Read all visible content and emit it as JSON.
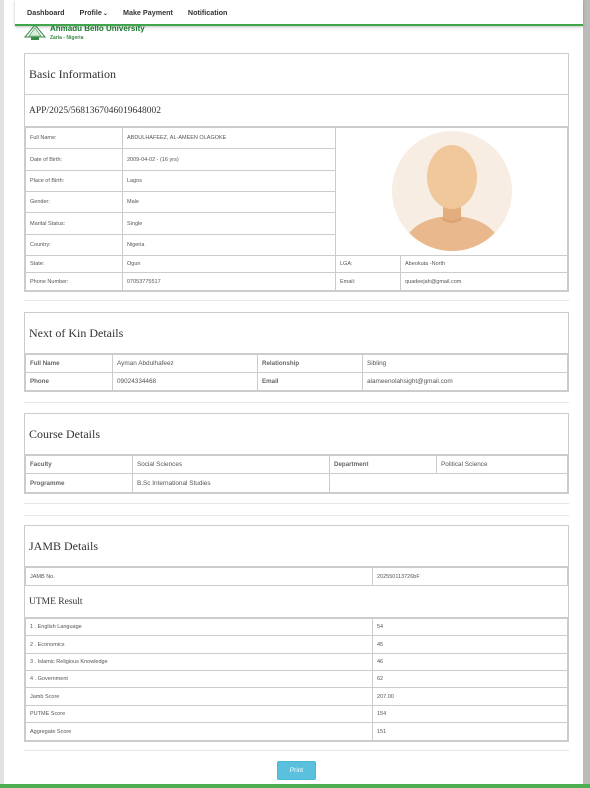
{
  "nav": {
    "dashboard": "Dashboard",
    "profile": "Profile",
    "payment": "Make Payment",
    "notification": "Notification"
  },
  "brand": {
    "name": "Ahmadu Bello University",
    "location": "Zaria - Nigeria"
  },
  "basic": {
    "title": "Basic Information",
    "app_no": "APP/2025/5681367046019648002",
    "rows": [
      {
        "label": "Full Name:",
        "value": "ABDULHAFEEZ, AL-AMEEN OLAGOKE"
      },
      {
        "label": "Date of Birth:",
        "value": "2009-04-02 - (16 yrs)"
      },
      {
        "label": "Place of Birth:",
        "value": "Lagos"
      },
      {
        "label": "Gender:",
        "value": "Male"
      },
      {
        "label": "Marital Status:",
        "value": "Single"
      },
      {
        "label": "Country:",
        "value": "Nigeria"
      }
    ],
    "state_label": "State:",
    "state": "Ogun",
    "lga_label": "LGA:",
    "lga": "Abeokuta -North",
    "phone_label": "Phone Number:",
    "phone": "07053775517",
    "email_label": "Email:",
    "email": "quadeejah@gmail.com"
  },
  "kin": {
    "title": "Next of Kin Details",
    "name_label": "Full Name",
    "name": "Ayman Abdulhafeez",
    "rel_label": "Relationship",
    "rel": "Sibling",
    "phone_label": "Phone",
    "phone": "09024334468",
    "email_label": "Email",
    "email": "alameenolahsight@gmail.com"
  },
  "course": {
    "title": "Course Details",
    "faculty_label": "Faculty",
    "faculty": "Social Sciences",
    "dept_label": "Department",
    "dept": "Political Science",
    "prog_label": "Programme",
    "prog": "B.Sc International Studies"
  },
  "jamb": {
    "title": "JAMB Details",
    "no_label": "JAMB No.",
    "no": "202550113726bF",
    "utme_title": "UTME Result",
    "rows": [
      {
        "label": "1 . English Language",
        "value": "54"
      },
      {
        "label": "2 . Economics",
        "value": "45"
      },
      {
        "label": "3 . Islamic Religious Knowledge",
        "value": "46"
      },
      {
        "label": "4 . Government",
        "value": "62"
      },
      {
        "label": "Jamb Score",
        "value": "207.00"
      },
      {
        "label": "PUTME Score",
        "value": "154"
      },
      {
        "label": "Aggregate Score",
        "value": "151"
      }
    ]
  },
  "print_label": "Print",
  "colors": {
    "nav_underline": "#3ea54a",
    "brand": "#1a7a2e",
    "print_button": "#5bc0de"
  }
}
